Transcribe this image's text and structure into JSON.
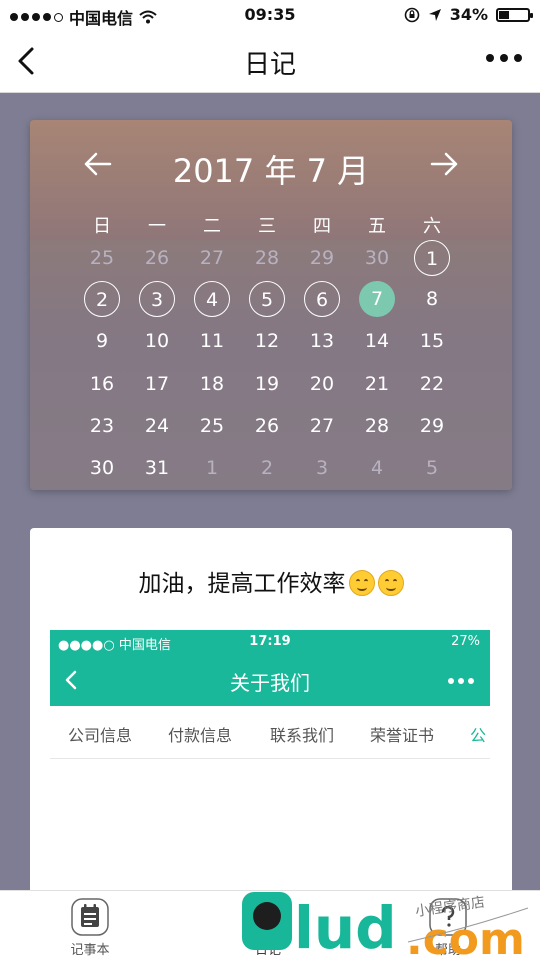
{
  "status_bar": {
    "carrier": "中国电信",
    "time": "09:35",
    "battery": "34%",
    "battery_level": 0.34
  },
  "nav": {
    "title": "日记"
  },
  "calendar": {
    "title": "2017 年 7 月",
    "weekdays": [
      "日",
      "一",
      "二",
      "三",
      "四",
      "五",
      "六"
    ],
    "weeks": [
      [
        {
          "d": "25",
          "dim": true
        },
        {
          "d": "26",
          "dim": true
        },
        {
          "d": "27",
          "dim": true
        },
        {
          "d": "28",
          "dim": true
        },
        {
          "d": "29",
          "dim": true
        },
        {
          "d": "30",
          "dim": true
        },
        {
          "d": "1",
          "marked": true
        }
      ],
      [
        {
          "d": "2",
          "marked": true
        },
        {
          "d": "3",
          "marked": true
        },
        {
          "d": "4",
          "marked": true
        },
        {
          "d": "5",
          "marked": true
        },
        {
          "d": "6",
          "marked": true
        },
        {
          "d": "7",
          "today": true
        },
        {
          "d": "8"
        }
      ],
      [
        {
          "d": "9"
        },
        {
          "d": "10"
        },
        {
          "d": "11"
        },
        {
          "d": "12"
        },
        {
          "d": "13"
        },
        {
          "d": "14"
        },
        {
          "d": "15"
        }
      ],
      [
        {
          "d": "16"
        },
        {
          "d": "17"
        },
        {
          "d": "18"
        },
        {
          "d": "19"
        },
        {
          "d": "20"
        },
        {
          "d": "21"
        },
        {
          "d": "22"
        }
      ],
      [
        {
          "d": "23"
        },
        {
          "d": "24"
        },
        {
          "d": "25"
        },
        {
          "d": "26"
        },
        {
          "d": "27"
        },
        {
          "d": "28"
        },
        {
          "d": "29"
        }
      ],
      [
        {
          "d": "30"
        },
        {
          "d": "31"
        },
        {
          "d": "1",
          "dim": true
        },
        {
          "d": "2",
          "dim": true
        },
        {
          "d": "3",
          "dim": true
        },
        {
          "d": "4",
          "dim": true
        },
        {
          "d": "5",
          "dim": true
        }
      ]
    ],
    "today_color": "#7dc9b0"
  },
  "diary": {
    "text": "加油，提高工作效率",
    "embedded_screenshot": {
      "carrier": "●●●●○ 中国电信",
      "time": "17:19",
      "battery": "27%",
      "title": "关于我们",
      "tabs": [
        "公司信息",
        "付款信息",
        "联系我们",
        "荣誉证书",
        "公"
      ],
      "accent_color": "#1ab89a"
    }
  },
  "tab_bar": {
    "items": [
      {
        "label": "记事本",
        "icon": "notepad-icon"
      },
      {
        "label": "日记",
        "icon": "pencil-icon"
      },
      {
        "label": "帮助",
        "icon": "help-icon"
      }
    ]
  },
  "watermark": {
    "text": "glud.com",
    "handwriting": "小程序商店"
  }
}
